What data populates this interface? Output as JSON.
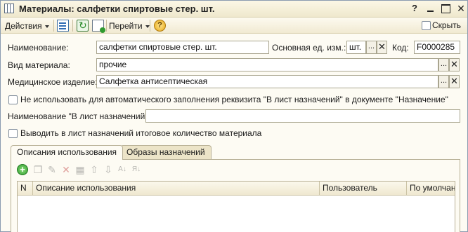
{
  "window": {
    "title": "Материалы: салфетки спиртовые стер. шт.",
    "help_glyph": "?",
    "close_glyph": "✕"
  },
  "toolbar": {
    "actions_label": "Действия",
    "goto_label": "Перейти",
    "help_glyph": "?",
    "hide_label": "Скрыть",
    "hide_checked": false
  },
  "form": {
    "name_label": "Наименование:",
    "name_value": "салфетки спиртовые стер. шт.",
    "unit_label": "Основная ед. изм.:",
    "unit_value": "шт.",
    "code_label": "Код:",
    "code_value": "F0000285",
    "type_label": "Вид материала:",
    "type_value": "прочие",
    "medical_label": "Медицинское изделие:",
    "medical_value": "Салфетка антисептическая",
    "no_autofill_label": "Не использовать для автоматического заполнения реквизита \"В лист назначений\" в документе \"Назначение\"",
    "no_autofill_checked": false,
    "sheet_name_label": "Наименование \"В лист назначений\":",
    "sheet_name_value": "",
    "output_total_label": "Выводить в лист назначений итоговое количество материала",
    "output_total_checked": false,
    "select_glyph": "...",
    "clear_glyph": "✕"
  },
  "tabs": [
    {
      "label": "Описания использования",
      "active": true
    },
    {
      "label": "Образы назначений",
      "active": false
    }
  ],
  "usage_table": {
    "columns": [
      "N",
      "Описание использования",
      "Пользователь",
      "По умолчанию"
    ],
    "rows": []
  }
}
